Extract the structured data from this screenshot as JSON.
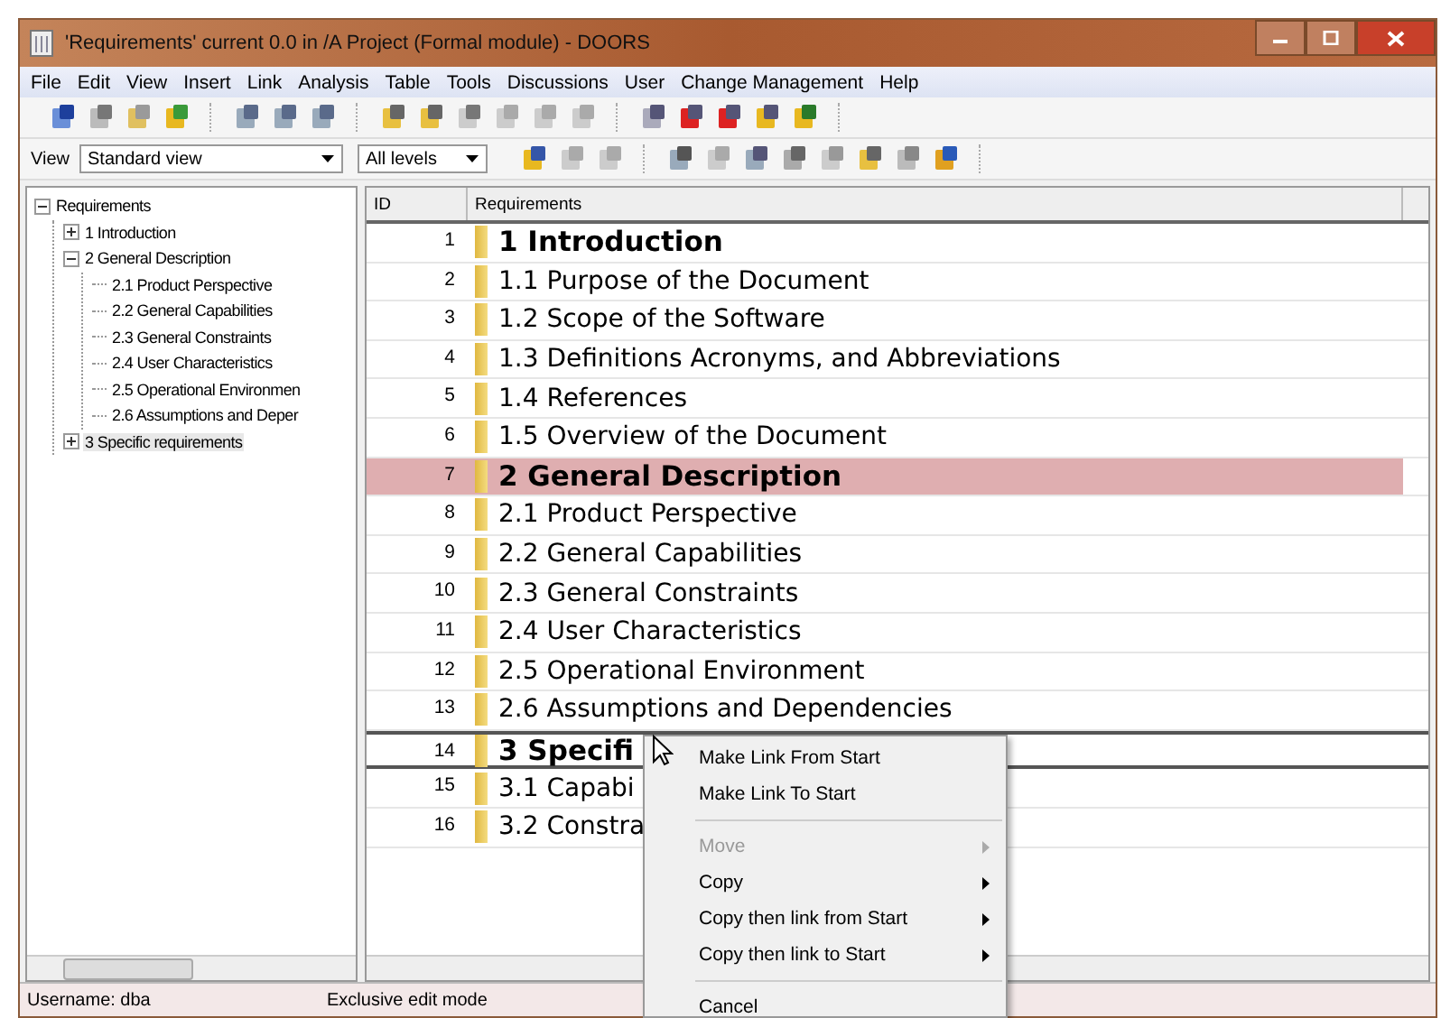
{
  "window": {
    "title": "'Requirements' current 0.0 in /A Project (Formal module) - DOORS"
  },
  "menu_bar": [
    "File",
    "Edit",
    "View",
    "Insert",
    "Link",
    "Analysis",
    "Table",
    "Tools",
    "Discussions",
    "User",
    "Change Management",
    "Help"
  ],
  "toolbar": {
    "view_label": "View",
    "view_select": "Standard view",
    "level_select": "All levels"
  },
  "tree": {
    "label": "Requirements",
    "expanded": true,
    "selected": false,
    "children": [
      {
        "label": "1 Introduction",
        "expanded": false,
        "selected": false
      },
      {
        "label": "2 General Description",
        "expanded": true,
        "selected": false,
        "children": [
          {
            "label": "2.1 Product Perspective",
            "selected": false
          },
          {
            "label": "2.2 General Capabilities",
            "selected": false
          },
          {
            "label": "2.3 General Constraints",
            "selected": false
          },
          {
            "label": "2.4 User Characteristics",
            "selected": false
          },
          {
            "label": "2.5 Operational Environmen",
            "selected": false
          },
          {
            "label": "2.6 Assumptions and Deper",
            "selected": false
          }
        ]
      },
      {
        "label": "3 Specific requirements",
        "expanded": false,
        "selected": true
      }
    ]
  },
  "table": {
    "columns": [
      "ID",
      "Requirements"
    ],
    "rows": [
      {
        "id": "1",
        "text": "1 Introduction",
        "kind": "heading",
        "selected": false,
        "current": false
      },
      {
        "id": "2",
        "text": "1.1 Purpose of the Document",
        "kind": "body",
        "selected": false,
        "current": false
      },
      {
        "id": "3",
        "text": "1.2 Scope of the Software",
        "kind": "body",
        "selected": false,
        "current": false
      },
      {
        "id": "4",
        "text": "1.3 Definitions Acronyms, and Abbreviations",
        "kind": "body",
        "selected": false,
        "current": false
      },
      {
        "id": "5",
        "text": "1.4 References",
        "kind": "body",
        "selected": false,
        "current": false
      },
      {
        "id": "6",
        "text": "1.5 Overview of the Document",
        "kind": "body",
        "selected": false,
        "current": false
      },
      {
        "id": "7",
        "text": "2 General Description",
        "kind": "heading",
        "selected": true,
        "current": false
      },
      {
        "id": "8",
        "text": "2.1 Product Perspective",
        "kind": "body",
        "selected": false,
        "current": false
      },
      {
        "id": "9",
        "text": "2.2 General Capabilities",
        "kind": "body",
        "selected": false,
        "current": false
      },
      {
        "id": "10",
        "text": "2.3 General Constraints",
        "kind": "body",
        "selected": false,
        "current": false
      },
      {
        "id": "11",
        "text": "2.4 User Characteristics",
        "kind": "body",
        "selected": false,
        "current": false
      },
      {
        "id": "12",
        "text": "2.5 Operational Environment",
        "kind": "body",
        "selected": false,
        "current": false
      },
      {
        "id": "13",
        "text": "2.6 Assumptions and Dependencies",
        "kind": "body",
        "selected": false,
        "current": false
      },
      {
        "id": "14",
        "text": "3 Specifi",
        "kind": "heading",
        "selected": false,
        "current": true
      },
      {
        "id": "15",
        "text": "3.1 Capabi",
        "kind": "body",
        "selected": false,
        "current": false
      },
      {
        "id": "16",
        "text": "3.2 Constra",
        "kind": "body",
        "selected": false,
        "current": false
      }
    ]
  },
  "context_menu": {
    "items": [
      {
        "kind": "item",
        "label": "Make Link From Start",
        "disabled": false,
        "submenu": false
      },
      {
        "kind": "item",
        "label": "Make Link To Start",
        "disabled": false,
        "submenu": false
      },
      {
        "kind": "separator"
      },
      {
        "kind": "item",
        "label": "Move",
        "disabled": true,
        "submenu": true
      },
      {
        "kind": "item",
        "label": "Copy",
        "disabled": false,
        "submenu": true
      },
      {
        "kind": "item",
        "label": "Copy then link from Start",
        "disabled": false,
        "submenu": true
      },
      {
        "kind": "item",
        "label": "Copy then link to Start",
        "disabled": false,
        "submenu": true
      },
      {
        "kind": "separator"
      },
      {
        "kind": "item",
        "label": "Cancel",
        "disabled": false,
        "submenu": false
      }
    ]
  },
  "status_bar": [
    "Username: dba",
    "Exclusive edit mode"
  ]
}
